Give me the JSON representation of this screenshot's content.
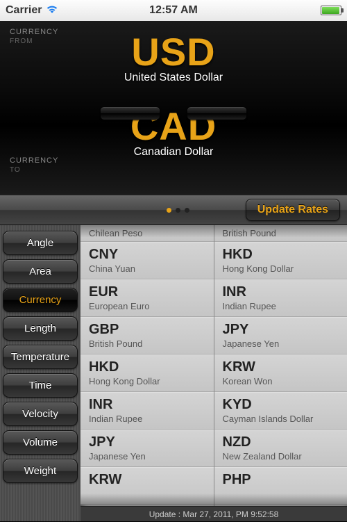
{
  "status": {
    "carrier": "Carrier",
    "time": "12:57 AM"
  },
  "flip": {
    "label_currency": "CURRENCY",
    "label_from": "FROM",
    "label_to": "TO",
    "from_code": "USD",
    "from_name": "United States Dollar",
    "to_code": "CAD",
    "to_name": "Canadian Dollar"
  },
  "toolbar": {
    "update_label": "Update Rates"
  },
  "categories": [
    {
      "label": "Angle"
    },
    {
      "label": "Area"
    },
    {
      "label": "Currency",
      "active": true
    },
    {
      "label": "Length"
    },
    {
      "label": "Temperature"
    },
    {
      "label": "Time"
    },
    {
      "label": "Velocity"
    },
    {
      "label": "Volume"
    },
    {
      "label": "Weight"
    }
  ],
  "left_list": [
    {
      "code": "",
      "name": "Chilean Peso",
      "partial": true
    },
    {
      "code": "CNY",
      "name": "China Yuan"
    },
    {
      "code": "EUR",
      "name": "European Euro"
    },
    {
      "code": "GBP",
      "name": "British Pound"
    },
    {
      "code": "HKD",
      "name": "Hong Kong Dollar"
    },
    {
      "code": "INR",
      "name": "Indian Rupee"
    },
    {
      "code": "JPY",
      "name": "Japanese Yen"
    },
    {
      "code": "KRW",
      "name": ""
    }
  ],
  "right_list": [
    {
      "code": "",
      "name": "British Pound",
      "partial": true
    },
    {
      "code": "HKD",
      "name": "Hong Kong Dollar"
    },
    {
      "code": "INR",
      "name": "Indian Rupee"
    },
    {
      "code": "JPY",
      "name": "Japanese Yen"
    },
    {
      "code": "KRW",
      "name": "Korean Won"
    },
    {
      "code": "KYD",
      "name": "Cayman Islands Dollar"
    },
    {
      "code": "NZD",
      "name": "New Zealand Dollar"
    },
    {
      "code": "PHP",
      "name": ""
    }
  ],
  "footer": {
    "update_text": "Update : Mar 27, 2011, PM 9:52:58"
  },
  "colors": {
    "accent": "#e8a318"
  }
}
